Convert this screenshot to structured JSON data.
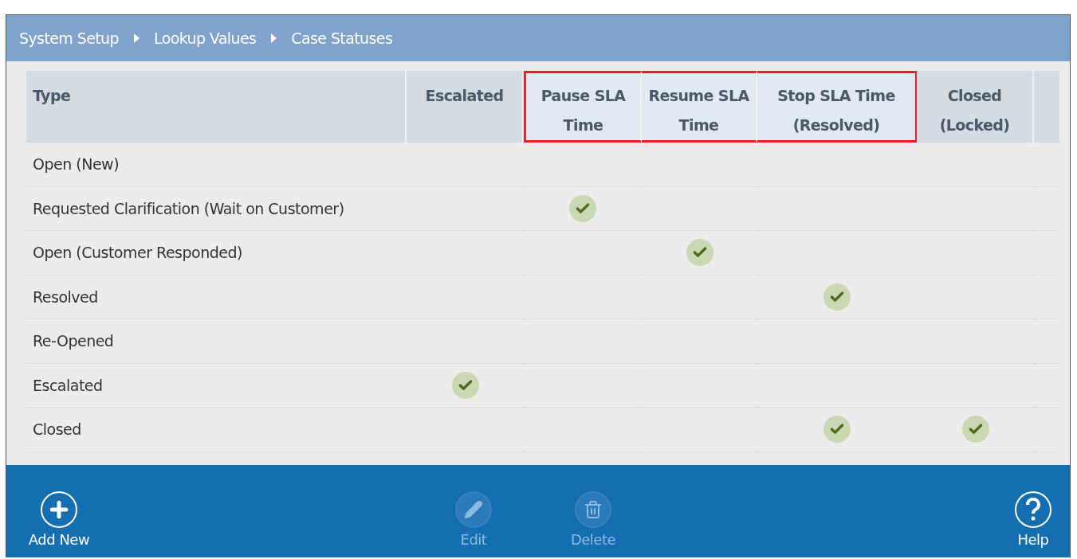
{
  "breadcrumb": [
    "System Setup",
    "Lookup Values",
    "Case Statuses"
  ],
  "table": {
    "columns": [
      {
        "label": "Type",
        "highlighted": false
      },
      {
        "label": "Escalated",
        "highlighted": false
      },
      {
        "label": "Pause SLA Time",
        "highlighted": true
      },
      {
        "label": "Resume SLA Time",
        "highlighted": true
      },
      {
        "label": "Stop SLA Time (Resolved)",
        "highlighted": true
      },
      {
        "label": "Closed (Locked)",
        "highlighted": false
      }
    ],
    "rows": [
      {
        "type": "Open (New)",
        "checks": [
          false,
          false,
          false,
          false,
          false
        ]
      },
      {
        "type": "Requested Clarification (Wait on Customer)",
        "checks": [
          false,
          true,
          false,
          false,
          false
        ]
      },
      {
        "type": "Open (Customer Responded)",
        "checks": [
          false,
          false,
          true,
          false,
          false
        ]
      },
      {
        "type": "Resolved",
        "checks": [
          false,
          false,
          false,
          true,
          false
        ]
      },
      {
        "type": "Re-Opened",
        "checks": [
          false,
          false,
          false,
          false,
          false
        ]
      },
      {
        "type": "Escalated",
        "checks": [
          true,
          false,
          false,
          false,
          false
        ]
      },
      {
        "type": "Closed",
        "checks": [
          false,
          false,
          false,
          true,
          true
        ]
      }
    ]
  },
  "footer": {
    "buttons": [
      {
        "kind": "add",
        "label": "Add New",
        "disabled": false
      },
      {
        "kind": "edit",
        "label": "Edit",
        "disabled": true
      },
      {
        "kind": "delete",
        "label": "Delete",
        "disabled": true
      },
      {
        "kind": "help",
        "label": "Help",
        "disabled": false
      }
    ]
  }
}
